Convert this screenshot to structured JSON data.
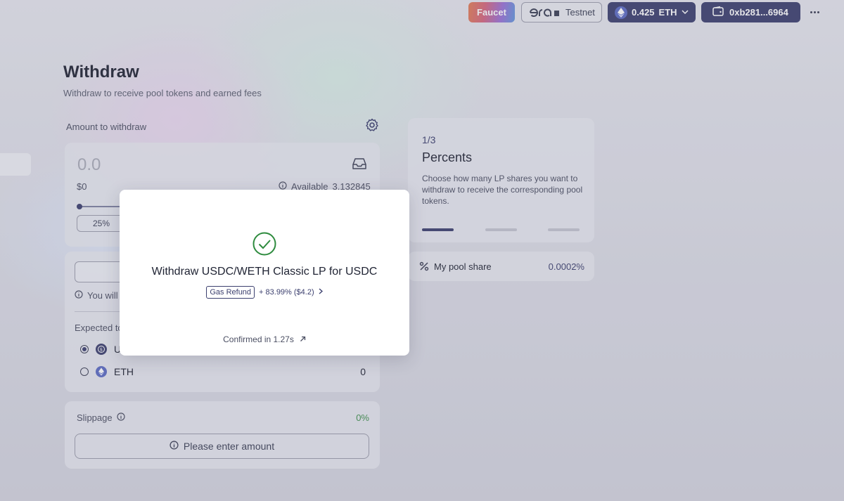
{
  "topbar": {
    "faucet_label": "Faucet",
    "network_brand": "era",
    "network_label": "Testnet",
    "eth_balance": "0.425",
    "eth_unit": "ETH",
    "wallet_address": "0xb281...6964"
  },
  "page": {
    "title": "Withdraw",
    "subtitle": "Withdraw to receive pool tokens and earned fees"
  },
  "amount": {
    "label": "Amount to withdraw",
    "value": "0.0",
    "usd": "$0",
    "available_label": "Available",
    "available_value": "3.132845",
    "percent_option": "25%"
  },
  "receive": {
    "info_text": "You will",
    "expected_label": "Expected to",
    "tokens": [
      {
        "symbol": "U",
        "amount": "",
        "selected": true
      },
      {
        "symbol": "ETH",
        "amount": "0",
        "selected": false
      }
    ]
  },
  "slippage": {
    "label": "Slippage",
    "value": "0%",
    "button_label": "Please enter amount"
  },
  "steps": {
    "counter": "1/3",
    "title": "Percents",
    "description": "Choose how many LP shares you want to withdraw to receive the corresponding pool tokens.",
    "current": 1,
    "total": 3
  },
  "pool_share": {
    "label": "My pool share",
    "value": "0.0002%"
  },
  "modal": {
    "title": "Withdraw USDC/WETH Classic LP for USDC",
    "badge": "Gas Refund",
    "refund_value": "+ 83.99% ($4.2)",
    "confirmed_text": "Confirmed in 1.27s"
  },
  "colors": {
    "accent": "#3b3f6e",
    "success": "#2e8b3e",
    "slippage_green": "#3f8f4d"
  }
}
